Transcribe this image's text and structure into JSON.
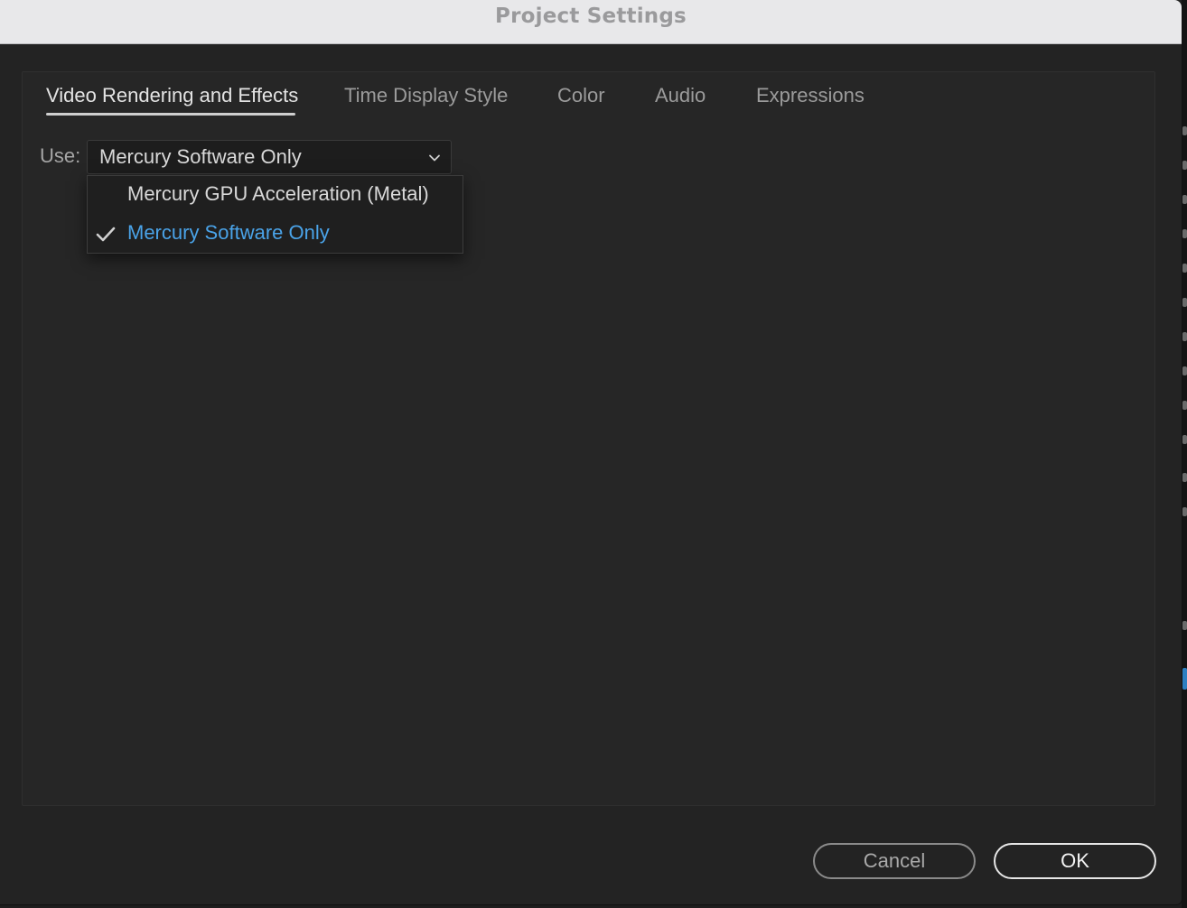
{
  "window": {
    "title": "Project Settings"
  },
  "tabs": [
    {
      "label": "Video Rendering and Effects",
      "active": true
    },
    {
      "label": "Time Display Style",
      "active": false
    },
    {
      "label": "Color",
      "active": false
    },
    {
      "label": "Audio",
      "active": false
    },
    {
      "label": "Expressions",
      "active": false
    }
  ],
  "renderer": {
    "label": "Use:",
    "selected_value": "Mercury Software Only",
    "options": [
      {
        "label": "Mercury GPU Acceleration (Metal)",
        "checked": false
      },
      {
        "label": "Mercury Software Only",
        "checked": true
      }
    ],
    "icons": {
      "dropdown": "chevron-down-icon",
      "selected": "checkmark-icon"
    }
  },
  "buttons": {
    "cancel": "Cancel",
    "ok": "OK"
  },
  "colors": {
    "selected_option": "#4aa3e8",
    "dialog_background": "#232323",
    "titlebar_background": "#e8e8ea"
  }
}
